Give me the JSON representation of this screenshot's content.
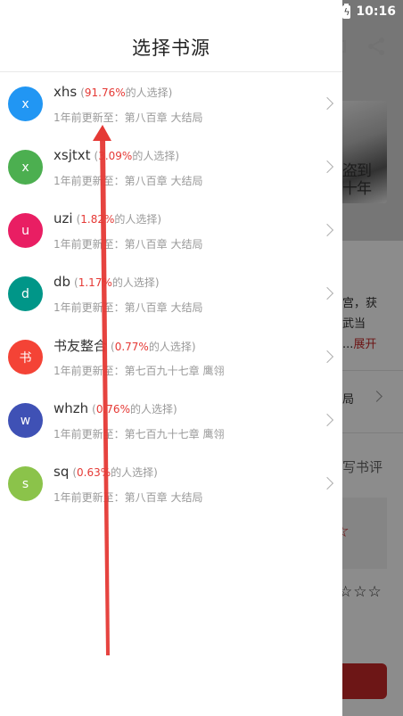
{
  "status_bar": {
    "time": "10:16"
  },
  "background": {
    "cover_text": "盗到\n十年",
    "desc_line1": "宫，获",
    "desc_line2": "武当",
    "desc_more": "...",
    "expand_label": "展开",
    "chapter_text": "局",
    "write_review": "写书评",
    "stars": "☆☆☆",
    "red_star": "☆"
  },
  "drawer": {
    "title": "选择书源",
    "pct_suffix": "的人选择)",
    "pct_prefix": "(",
    "sources": [
      {
        "avatar": "x",
        "avatar_color": "#2196f3",
        "name": "xhs",
        "pct": "91.76%",
        "update_prefix": "1年前更新至：",
        "chapter": "第八百章 大结局"
      },
      {
        "avatar": "x",
        "avatar_color": "#4caf50",
        "name": "xsjtxt",
        "pct": "3.09%",
        "update_prefix": "1年前更新至：",
        "chapter": "第八百章 大结局"
      },
      {
        "avatar": "u",
        "avatar_color": "#e91e63",
        "name": "uzi",
        "pct": "1.82%",
        "update_prefix": "1年前更新至：",
        "chapter": "第八百章 大结局"
      },
      {
        "avatar": "d",
        "avatar_color": "#009688",
        "name": "db",
        "pct": "1.17%",
        "update_prefix": "1年前更新至：",
        "chapter": "第八百章 大结局"
      },
      {
        "avatar": "书",
        "avatar_color": "#f44336",
        "name": "书友整合",
        "pct": "0.77%",
        "update_prefix": "1年前更新至：",
        "chapter": "第七百九十七章 鹰翎"
      },
      {
        "avatar": "w",
        "avatar_color": "#3f51b5",
        "name": "whzh",
        "pct": "0.76%",
        "update_prefix": "1年前更新至：",
        "chapter": "第七百九十七章 鹰翎"
      },
      {
        "avatar": "s",
        "avatar_color": "#8bc34a",
        "name": "sq",
        "pct": "0.63%",
        "update_prefix": "1年前更新至：",
        "chapter": "第八百章 大结局"
      }
    ]
  },
  "colors": {
    "accent_red": "#e53935",
    "arrow_red": "#e53935"
  }
}
